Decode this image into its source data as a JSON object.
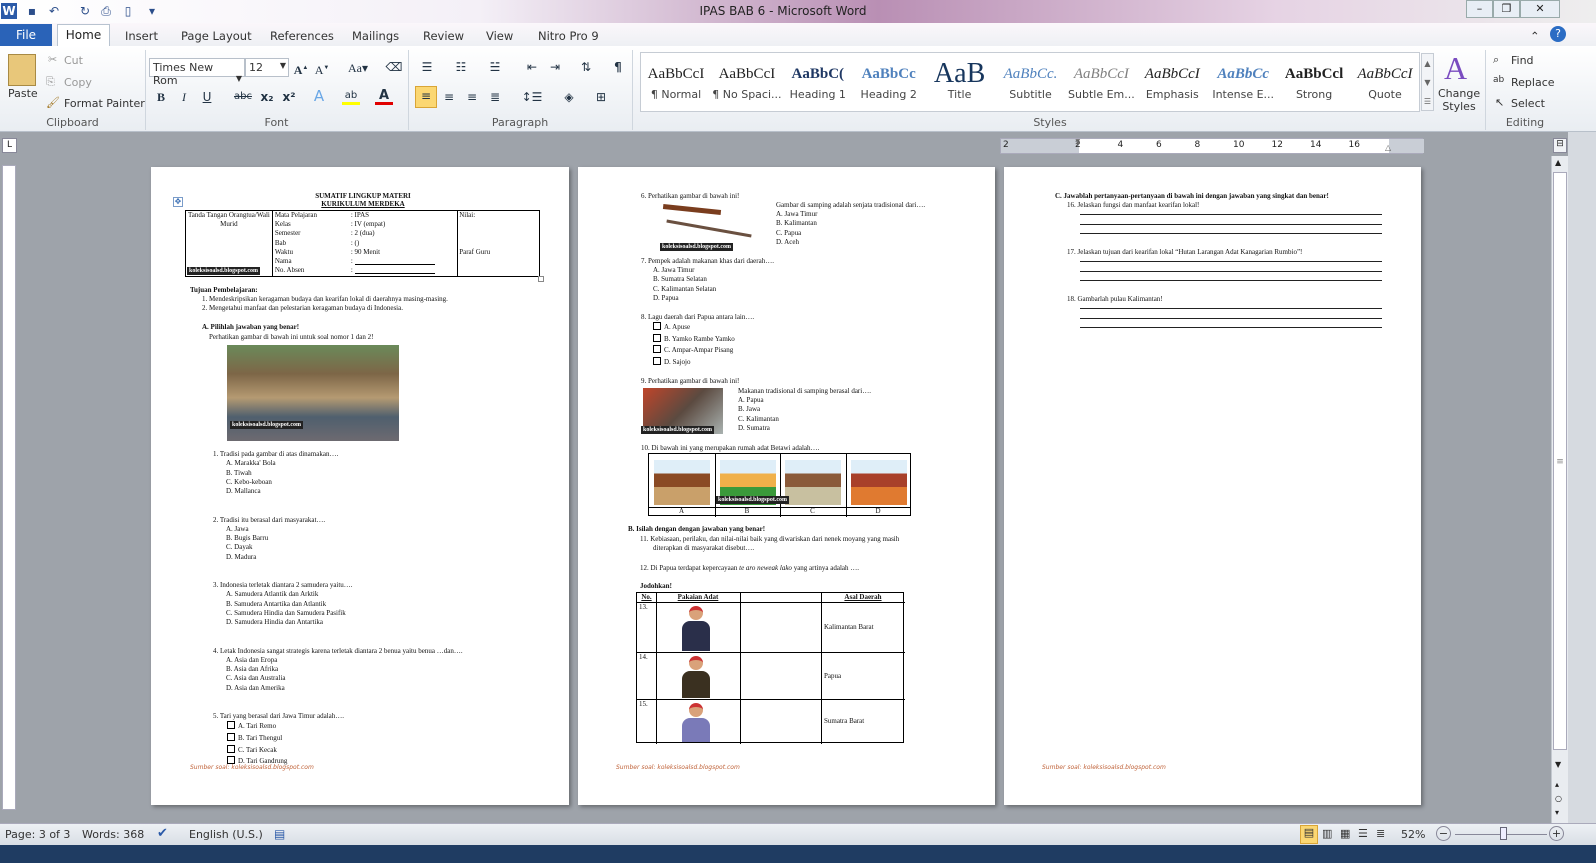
{
  "window": {
    "title": "IPAS BAB 6  -  Microsoft Word"
  },
  "quick_access": [
    "word-icon",
    "save-icon",
    "undo-icon",
    "redo-icon",
    "print-preview-icon",
    "new-doc-icon",
    "customize-icon"
  ],
  "tabs": [
    "File",
    "Home",
    "Insert",
    "Page Layout",
    "References",
    "Mailings",
    "Review",
    "View",
    "Nitro Pro 9"
  ],
  "ribbon": {
    "clipboard": {
      "paste": "Paste",
      "cut": "Cut",
      "copy": "Copy",
      "format_painter": "Format Painter",
      "label": "Clipboard"
    },
    "font": {
      "name": "Times New Rom",
      "size": "12",
      "label": "Font",
      "highlight_color": "#ffff00",
      "font_color": "#e00000"
    },
    "paragraph": {
      "label": "Paragraph"
    },
    "styles": {
      "label": "Styles",
      "items": [
        {
          "sample": "AaBbCcI",
          "name": "¶ Normal"
        },
        {
          "sample": "AaBbCcI",
          "name": "¶ No Spaci..."
        },
        {
          "sample": "AaBbC(",
          "name": "Heading 1"
        },
        {
          "sample": "AaBbCc",
          "name": "Heading 2"
        },
        {
          "sample": "AaB",
          "name": "Title"
        },
        {
          "sample": "AaBbCc.",
          "name": "Subtitle"
        },
        {
          "sample": "AaBbCcI",
          "name": "Subtle Em..."
        },
        {
          "sample": "AaBbCcI",
          "name": "Emphasis"
        },
        {
          "sample": "AaBbCc",
          "name": "Intense E..."
        },
        {
          "sample": "AaBbCcl",
          "name": "Strong"
        },
        {
          "sample": "AaBbCcI",
          "name": "Quote"
        }
      ],
      "change_styles": "Change Styles"
    },
    "editing": {
      "label": "Editing",
      "find": "Find",
      "replace": "Replace",
      "select": "Select"
    }
  },
  "ruler": {
    "ticks": [
      "2",
      "2",
      "4",
      "6",
      "8",
      "10",
      "12",
      "14",
      "16"
    ]
  },
  "page1": {
    "title1": "SUMATIF  LINGKUP  MATERI",
    "title2": "KURIKULUM  MERDEKA",
    "header": {
      "ttd": "Tanda Tangan Orangtua/Wali Murid",
      "labels": [
        "Mata Pelajaran",
        "Kelas",
        "Semester",
        "Bab",
        "Waktu",
        "Nama",
        "No. Absen"
      ],
      "values": [
        ": IPAS",
        ": IV (empat)",
        ": 2 (dua)",
        ":  ()",
        ": 90 Menit",
        ":",
        ":"
      ],
      "nilai": "Nilai:",
      "paraf": "Paraf Guru"
    },
    "watermark": "koleksisoalsd.blogspot.com",
    "tujuan": "Tujuan  Pembelajaran:",
    "tujuan_items": [
      "1.  Mendeskripsikan  keragaman budaya dan kearifan lokal di daerahnya masing-masing.",
      "2.  Mengetahui manfaat dan pelestarian keragaman budaya di Indonesia."
    ],
    "section_a": "A.  Pilihlah  jawaban  yang benar!",
    "instruction": "Perhatikan gambar di bawah ini untuk soal nomor 1 dan 2!",
    "questions": [
      {
        "q": "1.   Tradisi pada gambar di atas dinamakan….",
        "opts": [
          "A.  Marakka' Bola",
          "B.   Tiwah",
          "C.   Kebo-keboan",
          "D.   Mallanca"
        ],
        "cb": false
      },
      {
        "q": "2.   Tradisi itu berasal dari masyarakat….",
        "opts": [
          "A.  Jawa",
          "B.  Bugis  Barru",
          "C.  Dayak",
          "D.  Madura"
        ],
        "cb": false
      },
      {
        "q": "3.   Indonesia  terletak diantara 2 samudera yaitu….",
        "opts": [
          "A.  Samudera Atlantik  dan Arktik",
          "B.  Samudera Antartika  dan Atlantik",
          "C.  Samudera Hindia  dan Samudera  Pasifik",
          "D.  Samudera Hindia  dan Antartika"
        ],
        "cb": false
      },
      {
        "q": "4.   Letak Indonesia  sangat strategis karena terletak diantara 2 benua yaitu benua …dan….",
        "opts": [
          "A.  Asia dan Eropa",
          "B.  Asia dan Afrika",
          "C.  Asia dan Australia",
          "D.  Asia dan Amerika"
        ],
        "cb": false
      },
      {
        "q": "5.   Tari yang berasal dari Jawa Timur adalah….",
        "opts": [
          "A. Tari Remo",
          "B. Tari Thengul",
          "C. Tari Kecak",
          "D. Tari Gandrung"
        ],
        "cb": true
      }
    ],
    "footer": "Sumber soal:  koleksisoalsd.blogspot.com"
  },
  "page2": {
    "q6": {
      "q": "6.   Perhatikan gambar di bawah ini!",
      "side": "Gambar di samping adalah senjata tradisional dari….",
      "opts": [
        "A.  Jawa Timur",
        "B.  Kalimantan",
        "C.  Papua",
        "D.  Aceh"
      ]
    },
    "q7": {
      "q": "7.   Pempek adalah makanan khas dari daerah….",
      "opts": [
        "A.  Jawa Timur",
        "B.  Sumatra  Selatan",
        "C.  Kalimantan  Selatan",
        "D.  Papua"
      ]
    },
    "q8": {
      "q": "8.   Lagu daerah dari Papua antara lain….",
      "opts": [
        "A.   Apuse",
        "B.   Yamko  Rambe  Yamko",
        "C.   Ampar-Ampar Pisang",
        "D.   Sajojo"
      ]
    },
    "q9": {
      "q": "9.   Perhatikan gambar di bawah ini!",
      "side": "Makanan tradisional di samping berasal dari….",
      "opts": [
        "A.  Papua",
        "B.  Jawa",
        "C.  Kalimantan",
        "D.  Sumatra"
      ]
    },
    "q10": {
      "q": "10.  Di bawah ini yang merupakan rumah adat Betawi adalah….",
      "labels": [
        "A",
        "B",
        "C",
        "D"
      ]
    },
    "section_b": "B.  Isilah  dengan  dengan  jawaban  yang  benar!",
    "q11a": "11.  Kebiasaan, perilaku, dan nilai-nilai baik yang diwariskan dari nenek moyang yang masih",
    "q11b": "diterapkan di masyarakat disebut….",
    "q12a": "12.  Di Papua  terdapat kepercayaan ",
    "q12i": "te aro neweak lako",
    "q12b": " yang artinya  adalah ….",
    "jodohkan": "Jodohkan!",
    "match_headers": [
      "No.",
      "Pakaian Adat",
      "",
      "Asal Daerah"
    ],
    "match_rows": [
      {
        "no": "13.",
        "asal": "Kalimantan  Barat"
      },
      {
        "no": "14.",
        "asal": "Papua"
      },
      {
        "no": "15.",
        "asal": "Sumatra  Barat"
      }
    ],
    "watermark": "koleksisoalsd.blogspot.com",
    "footer": "Sumber soal:  koleksisoalsd.blogspot.com"
  },
  "page3": {
    "section_c": "C.  Jawablah  pertanyaan-pertanyaan   di bawah  ini dengan  jawaban  yang  singkat  dan  benar!",
    "questions": [
      "16.  Jelaskan fungsi dan manfaat kearifan lokal!",
      "17.  Jelaskan tujuan  dari kearifan lokal “Hutan Larangan Adat Kanagarian Rumbio”!",
      "18.  Gambarlah pulau  Kalimantan!"
    ],
    "footer": "Sumber soal:  koleksisoalsd.blogspot.com"
  },
  "status": {
    "page": "Page: 3 of 3",
    "words": "Words: 368",
    "language": "English (U.S.)",
    "zoom": "52%",
    "zoom_percent": 52
  }
}
